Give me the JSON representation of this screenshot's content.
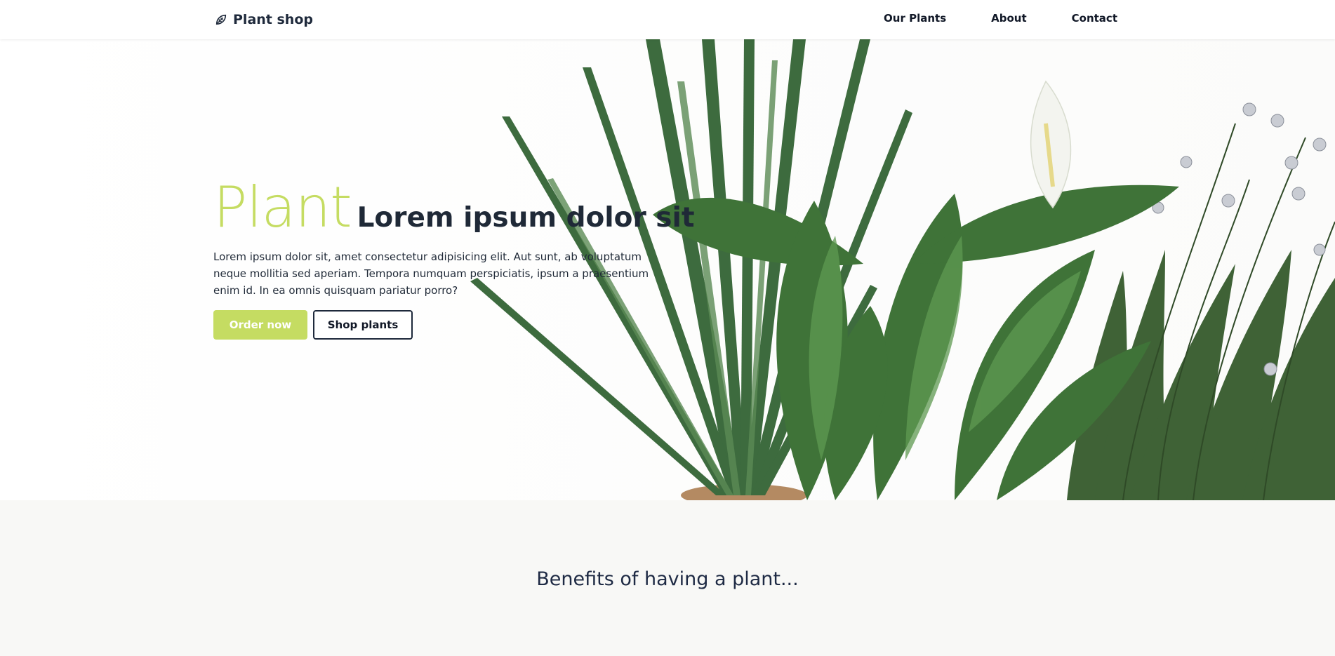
{
  "navbar": {
    "brand_icon": "leaf-icon",
    "brand_name": "Plant shop",
    "links": [
      {
        "label": "Our Plants"
      },
      {
        "label": "About"
      },
      {
        "label": "Contact"
      }
    ]
  },
  "hero": {
    "title_accent": "Plant",
    "title_rest": "Lorem ipsum dolor sit",
    "description": "Lorem ipsum dolor sit, amet consectetur adipisicing elit. Aut sunt, ab voluptatum neque mollitia sed aperiam. Tempora numquam perspiciatis, ipsum a praesentium enim id. In ea omnis quisquam pariatur porro?",
    "buttons": {
      "primary": "Order now",
      "secondary": "Shop plants"
    },
    "image": "potted-plants-illustration"
  },
  "benefits": {
    "title": "Benefits of having a plant..."
  },
  "colors": {
    "accent": "#c5dc62",
    "dark": "#1e293b",
    "section_bg": "#f8f8f6"
  }
}
